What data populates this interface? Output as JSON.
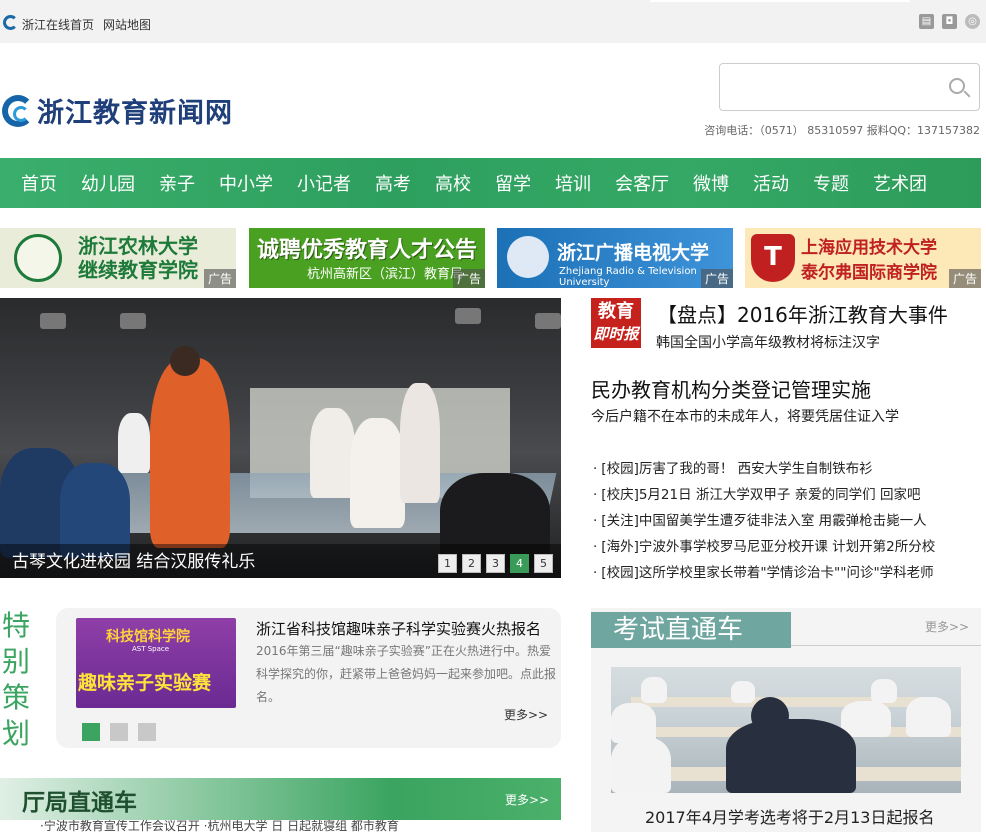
{
  "topbar": {
    "home_link": "浙江在线首页",
    "sitemap_link": "网站地图",
    "icons": [
      "bookmark-icon",
      "camera-icon",
      "globe-icon"
    ]
  },
  "brand": {
    "title": "浙江教育新闻网"
  },
  "search": {
    "placeholder": ""
  },
  "contact": {
    "text": "咨询电话：（0571） 85310597  报料QQ：137157382"
  },
  "nav": {
    "items": [
      "首页",
      "幼儿园",
      "亲子",
      "中小学",
      "小记者",
      "高考",
      "高校",
      "留学",
      "培训",
      "会客厅",
      "微博",
      "活动",
      "专题",
      "艺术团"
    ]
  },
  "ads": {
    "tag": "广告",
    "ad1": {
      "line1": "浙江农林大学",
      "line2": "继续教育学院"
    },
    "ad2": {
      "line1": "诚聘优秀教育人才公告",
      "line2": "杭州高新区（滨江）教育局"
    },
    "ad3": {
      "line1": "浙江广播电视大学",
      "line2": "Zhejiang Radio & Television University"
    },
    "ad4": {
      "logo": "T",
      "line1": "上海应用技术大学",
      "line2": "泰尔弗国际商学院"
    }
  },
  "slide": {
    "caption": "古琴文化进校园 结合汉服传礼乐",
    "pages": [
      "1",
      "2",
      "3",
      "4",
      "5"
    ],
    "active_page": "4"
  },
  "news": {
    "badge_line1": "教育",
    "badge_line2": "即时报",
    "headline1": "【盘点】2016年浙江教育大事件",
    "sub1": "韩国全国小学高年级教材将标注汉字",
    "headline2": "民办教育机构分类登记管理实施",
    "sub2": "今后户籍不在本市的未成年人，将要凭居住证入学",
    "items": [
      "[校园]厉害了我的哥！  西安大学生自制铁布衫",
      "[校庆]5月21日  浙江大学双甲子  亲爱的同学们  回家吧",
      "[关注]中国留美学生遭歹徒非法入室  用霰弹枪击毙一人",
      "[海外]宁波外事学校罗马尼亚分校开课  计划开第2所分校",
      "[校园]这所学校里家长带着\"学情诊治卡\"\"问诊\"学科老师"
    ]
  },
  "special": {
    "label": [
      "特",
      "别",
      "策",
      "划"
    ],
    "img_title": "科技馆科学院",
    "img_sub": "AST Space",
    "img_main": "趣味亲子实验赛",
    "title": "浙江省科技馆趣味亲子科学实验赛火热报名",
    "desc": "2016年第三届“趣味亲子实验赛”正在火热进行中。热爱科学探究的你，赶紧带上爸爸妈妈一起来参加吧。点此报名。",
    "more": "更多>>"
  },
  "exam": {
    "title": "考试直通车",
    "more": "更多>>",
    "caption": "2017年4月学考选考将于2月13日起报名"
  },
  "bureau": {
    "title": "厅局直通车",
    "more": "更多>>",
    "strip": "·宁波市教育宣传工作会议召开      ·杭州电大学 日 日起就寝组 都市教育"
  }
}
